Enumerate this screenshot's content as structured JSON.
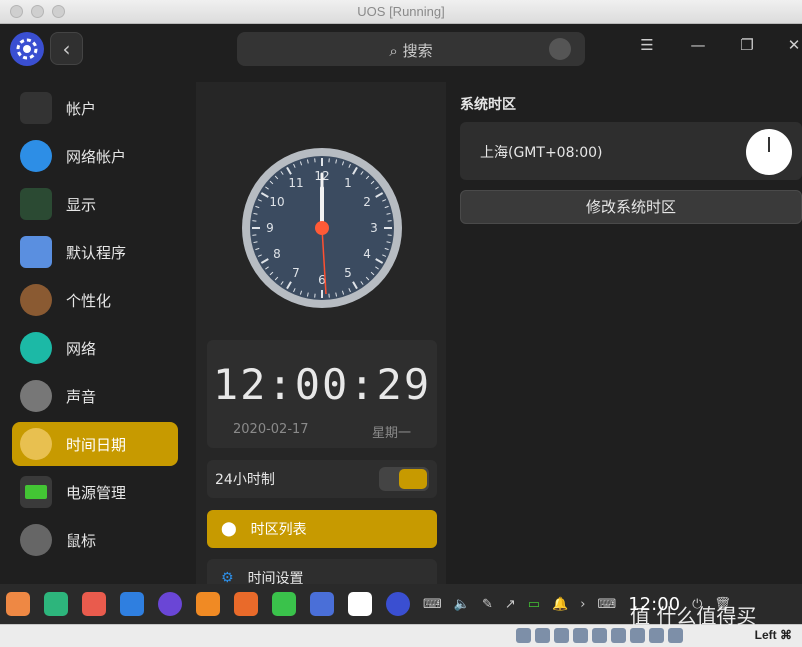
{
  "window": {
    "title": "UOS [Running]"
  },
  "header": {
    "search_label": "搜索"
  },
  "sidebar": {
    "items": [
      {
        "label": "帐户",
        "icon": "user-avatar-icon"
      },
      {
        "label": "网络帐户",
        "icon": "cloud-icon"
      },
      {
        "label": "显示",
        "icon": "monitor-icon"
      },
      {
        "label": "默认程序",
        "icon": "default-apps-icon"
      },
      {
        "label": "个性化",
        "icon": "palette-icon"
      },
      {
        "label": "网络",
        "icon": "network-icon"
      },
      {
        "label": "声音",
        "icon": "speaker-icon"
      },
      {
        "label": "时间日期",
        "icon": "clock-icon"
      },
      {
        "label": "电源管理",
        "icon": "battery-icon"
      },
      {
        "label": "鼠标",
        "icon": "mouse-icon"
      }
    ],
    "active_index": 7,
    "accent": "#c79a00"
  },
  "clock_face": {
    "numbers": [
      "12",
      "1",
      "2",
      "3",
      "4",
      "5",
      "6",
      "7",
      "8",
      "9",
      "10",
      "11"
    ],
    "hour": 12,
    "minute": 0,
    "second": 29
  },
  "digital": {
    "time": "12:00:29",
    "date": "2020-02-17",
    "weekday": "星期一"
  },
  "settings": {
    "format_label": "24小时制",
    "format_on": true,
    "timezone_list_label": "时区列表",
    "time_settings_label": "时间设置"
  },
  "timezone": {
    "heading": "系统时区",
    "current": "上海(GMT+08:00)",
    "change_button": "修改系统时区"
  },
  "dock": {
    "time": "12:00"
  },
  "statusbar": {
    "host_key": "Left ⌘"
  },
  "watermark": "值 什么值得买"
}
